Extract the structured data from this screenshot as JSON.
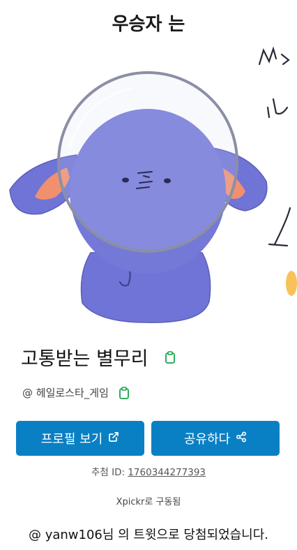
{
  "header": {
    "title": "우승자 는"
  },
  "winner": {
    "display_name": "고통받는 별무리",
    "handle": "@ 헤일로스타_게임"
  },
  "buttons": {
    "profile_label": "프로필 보기",
    "share_label": "공유하다"
  },
  "draw": {
    "id_label": "추첨 ID:",
    "id_value": "1760344277393"
  },
  "footer": {
    "powered_by": "Xpickr로 구동됨",
    "result_text": "@ yanw106님 의 트윗으로 당첨되었습니다."
  },
  "colors": {
    "button_bg": "#0a80c4",
    "copy_icon": "#16a34a"
  },
  "icons": {
    "copy": "clipboard-icon",
    "external": "external-link-icon",
    "share": "share-icon"
  }
}
